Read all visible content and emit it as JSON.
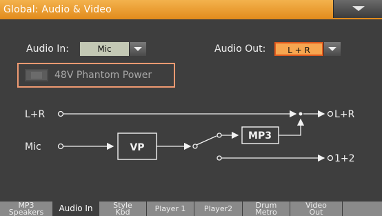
{
  "window": {
    "title": "Global: Audio & Video",
    "menu_icon": "triangle-down-icon"
  },
  "audio_in": {
    "label": "Audio In:",
    "value": "Mic"
  },
  "audio_out": {
    "label": "Audio Out:",
    "value": "L + R"
  },
  "phantom_power": {
    "label": "48V Phantom Power",
    "checked": false
  },
  "diagram": {
    "lr_in": "L+R",
    "mic_in": "Mic",
    "vp_block": "VP",
    "mp3_block": "MP3",
    "lr_out": "L+R",
    "out_12": "1+2"
  },
  "tabs": [
    {
      "line1": "MP3",
      "line2": "Speakers"
    },
    {
      "line1": "Audio In",
      "line2": ""
    },
    {
      "line1": "Style",
      "line2": "Kbd"
    },
    {
      "line1": "Player 1",
      "line2": ""
    },
    {
      "line1": "Player2",
      "line2": ""
    },
    {
      "line1": "Drum",
      "line2": "Metro"
    },
    {
      "line1": "Video",
      "line2": "Out"
    }
  ],
  "colors": {
    "title_bar": "#e89a2a",
    "highlight": "#f6a650",
    "frame": "#ef9a72"
  }
}
